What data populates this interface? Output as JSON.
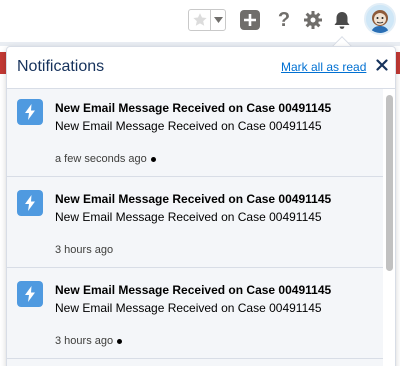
{
  "topbar": {
    "favorites_icon": "star-icon",
    "favorites_menu_icon": "chevron-down-icon",
    "add_icon": "plus-icon",
    "help_label": "?",
    "settings_icon": "gear-icon",
    "notifications_icon": "bell-icon",
    "avatar_icon": "avatar-icon"
  },
  "panel": {
    "title": "Notifications",
    "mark_all_read": "Mark all as read",
    "close_icon": "close-icon"
  },
  "notifications": [
    {
      "title": "New Email Message Received on Case 00491145",
      "body": "New Email Message Received on Case 00491145",
      "time": "a few seconds ago",
      "unread": true
    },
    {
      "title": "New Email Message Received on Case 00491145",
      "body": "New Email Message Received on Case 00491145",
      "time": "3 hours ago",
      "unread": false
    },
    {
      "title": "New Email Message Received on Case 00491145",
      "body": "New Email Message Received on Case 00491145",
      "time": "3 hours ago",
      "unread": true
    }
  ],
  "colors": {
    "accent": "#0070d2",
    "icon_bg": "#4f9ae0",
    "brand_red": "#c23934"
  }
}
